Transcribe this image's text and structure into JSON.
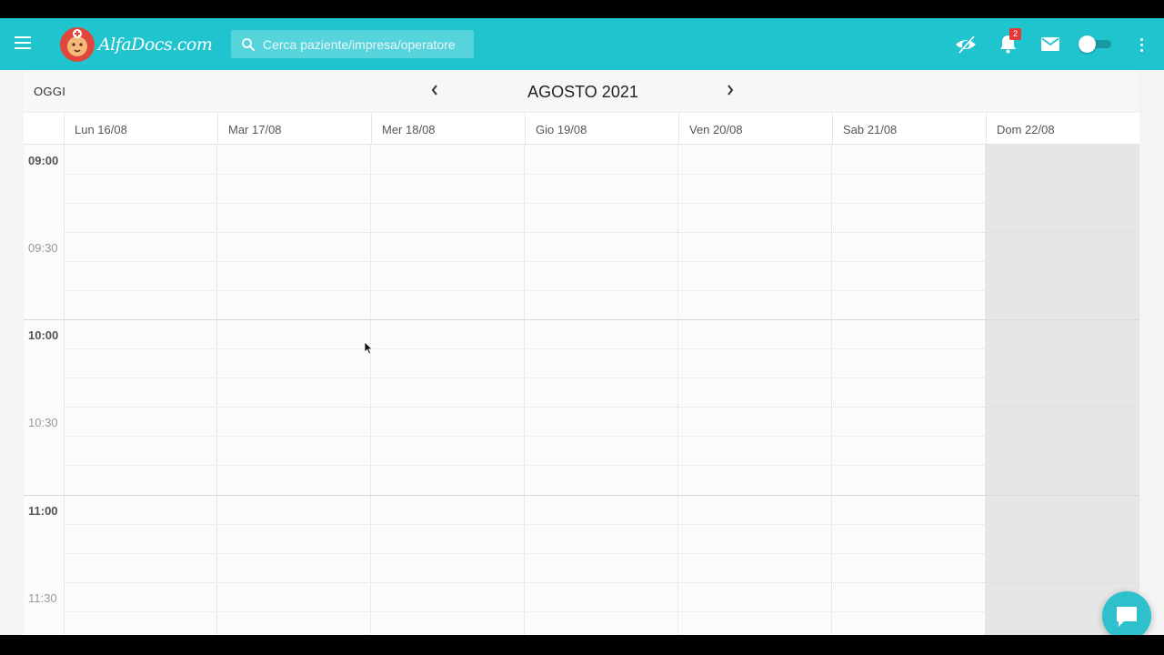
{
  "header": {
    "brand": "AlfaDocs.com",
    "search": {
      "placeholder": "Cerca paziente/impresa/operatore",
      "value": ""
    },
    "notifications_count": "2",
    "icons": [
      "menu-icon",
      "privacy-eye-icon",
      "bell-icon",
      "mail-icon",
      "toggle-switch",
      "more-vert-icon"
    ]
  },
  "calendar": {
    "today_label": "OGGI",
    "title": "AGOSTO 2021",
    "days": [
      {
        "label": "Lun 16/08"
      },
      {
        "label": "Mar 17/08"
      },
      {
        "label": "Mer 18/08"
      },
      {
        "label": "Gio 19/08"
      },
      {
        "label": "Ven 20/08"
      },
      {
        "label": "Sab 21/08"
      },
      {
        "label": "Dom 22/08"
      }
    ],
    "times": [
      "09:00",
      "09:30",
      "10:00",
      "10:30",
      "11:00",
      "11:30"
    ]
  },
  "colors": {
    "topbar": "#1fc4cf",
    "badge": "#e53935",
    "chat": "#2ec1cd",
    "sunday_bg": "#e6e6e6"
  }
}
